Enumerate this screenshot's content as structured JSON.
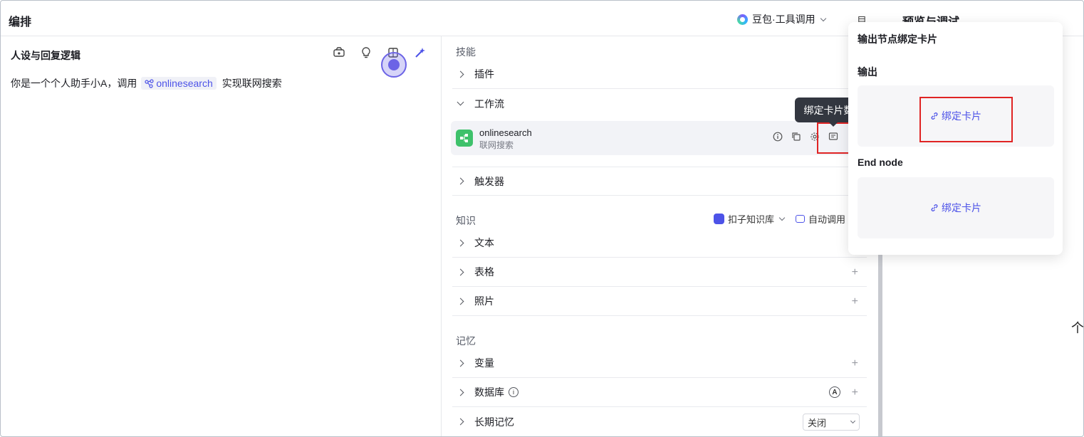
{
  "header": {
    "title": "编排",
    "model": "豆包·工具调用",
    "layout_icon_text": "目",
    "preview_title": "预览与调试"
  },
  "persona": {
    "title": "人设与回复逻辑",
    "prompt_prefix": "你是一个个人助手小A，调用",
    "prompt_ref": "onlinesearch",
    "prompt_suffix": "实现联网搜索"
  },
  "skills": {
    "label": "技能",
    "plugin": "插件",
    "auto_badge": "A",
    "workflow": "工作流",
    "workflow_item": {
      "name": "onlinesearch",
      "desc": "联网搜索"
    },
    "trigger": "触发器",
    "tooltip": "绑定卡片数据"
  },
  "knowledge": {
    "label": "知识",
    "source": "扣子知识库",
    "mode": "自动调用",
    "items": [
      "文本",
      "表格",
      "照片"
    ],
    "plus": "+"
  },
  "memory": {
    "label": "记忆",
    "variables": "变量",
    "database": "数据库",
    "info": "i",
    "long_term": "长期记忆",
    "long_term_value": "关闭"
  },
  "popover": {
    "title": "输出节点绑定卡片",
    "section_output": "输出",
    "section_end": "End node",
    "bind_label": "绑定卡片"
  },
  "misc": {
    "scroll_up": "个"
  }
}
